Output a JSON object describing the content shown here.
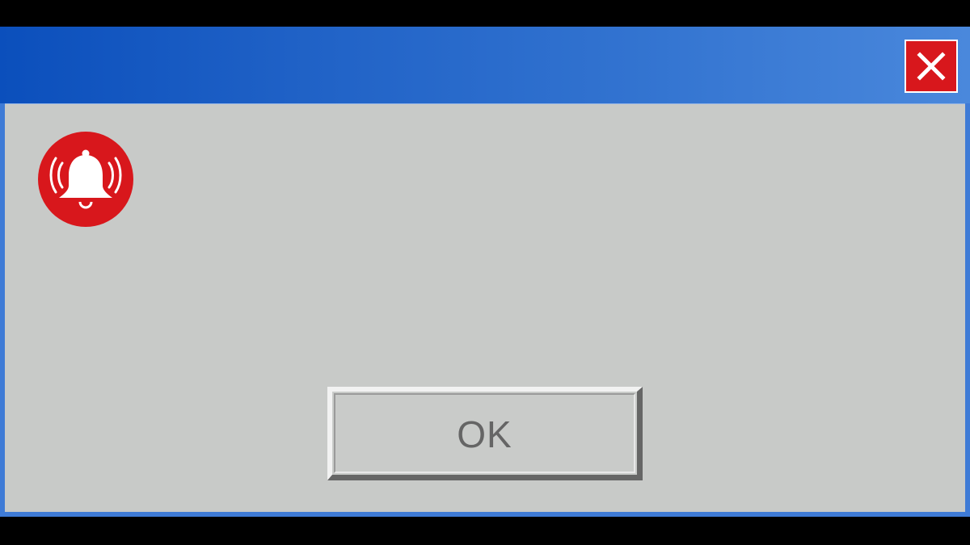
{
  "window": {
    "title": "",
    "message": "",
    "colors": {
      "titlebar_start": "#0b4fbc",
      "titlebar_end": "#4a88dc",
      "body": "#c8cac8",
      "close_button": "#d8171c",
      "alert_icon": "#d8171c"
    }
  },
  "icons": {
    "close": "close-icon",
    "alert": "alarm-bell-icon"
  },
  "buttons": {
    "ok_label": "OK"
  }
}
